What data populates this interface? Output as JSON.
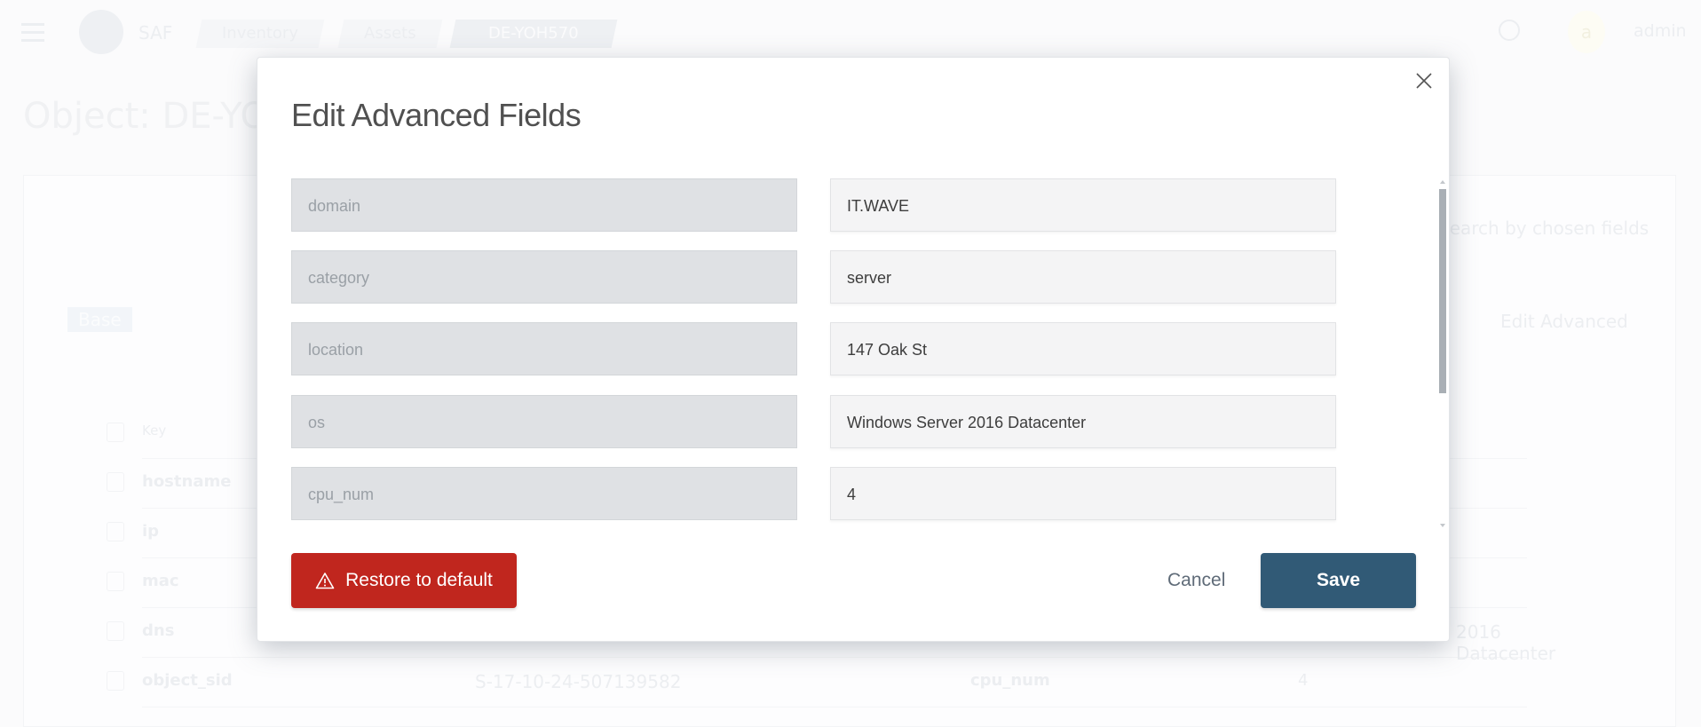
{
  "header": {
    "brand": "SAF",
    "breadcrumbs": [
      "Inventory",
      "Assets",
      "DE-YOH570"
    ],
    "avatar_letter": "a",
    "username": "admin"
  },
  "page": {
    "title": "Object: DE-YOH570",
    "tab_base": "Base",
    "search_placeholder": "Search by chosen fields",
    "edit_advanced": "Edit Advanced",
    "table_header_key": "Key",
    "table_rows": [
      {
        "key": "hostname",
        "value": "",
        "key2": "",
        "value2": ""
      },
      {
        "key": "ip",
        "value": "",
        "key2": "",
        "value2": ""
      },
      {
        "key": "mac",
        "value": "",
        "key2": "",
        "value2": ""
      },
      {
        "key": "dns",
        "value": "",
        "key2": "",
        "value2": "2016 Datacenter"
      },
      {
        "key": "object_sid",
        "value": "S-17-10-24-507139582",
        "key2": "cpu_num",
        "value2": "4"
      }
    ]
  },
  "modal": {
    "title": "Edit Advanced Fields",
    "fields": [
      {
        "key": "domain",
        "value": "IT.WAVE"
      },
      {
        "key": "category",
        "value": "server"
      },
      {
        "key": "location",
        "value": "147 Oak St"
      },
      {
        "key": "os",
        "value": "Windows Server 2016 Datacenter"
      },
      {
        "key": "cpu_num",
        "value": "4"
      }
    ],
    "restore_label": "Restore to default",
    "cancel_label": "Cancel",
    "save_label": "Save"
  },
  "colors": {
    "restore": "#c0261e",
    "save": "#315a76",
    "key_field": "#dfe1e4",
    "value_field": "#f4f4f5"
  }
}
